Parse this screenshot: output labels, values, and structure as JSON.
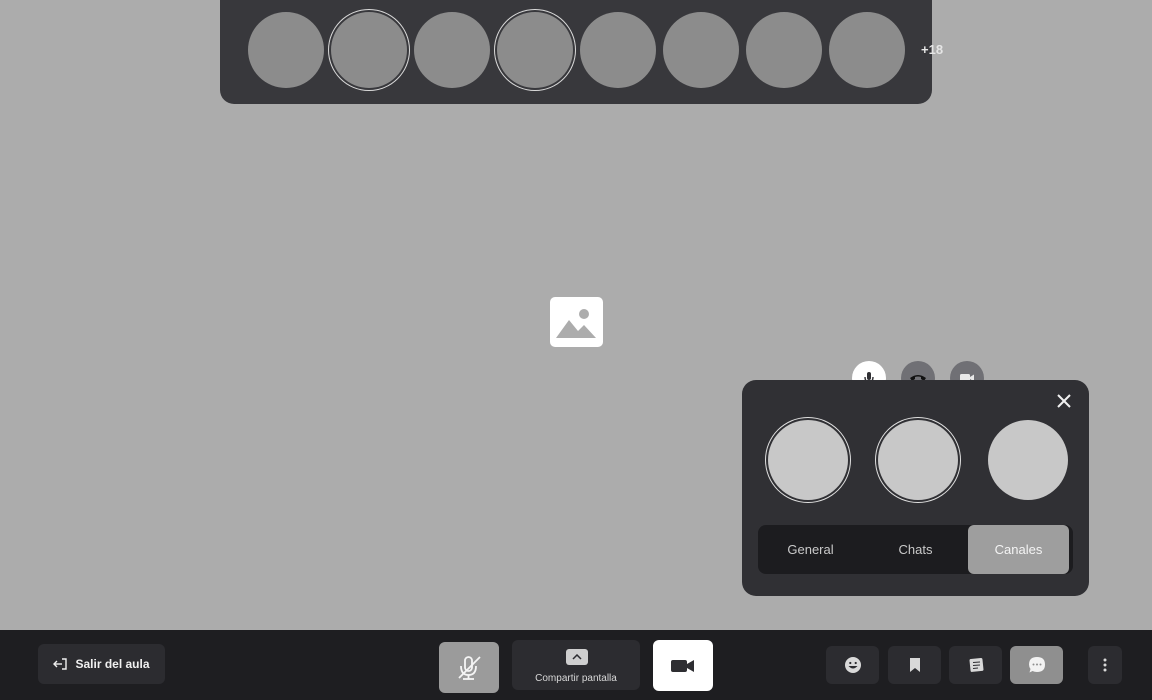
{
  "participants": {
    "more_count": "+18"
  },
  "call_panel": {
    "tabs": [
      {
        "label": "General"
      },
      {
        "label": "Chats"
      },
      {
        "label": "Canales"
      }
    ],
    "active_tab": "Canales"
  },
  "toolbar": {
    "leave_label": "Salir del aula",
    "share_label": "Compartir pantalla"
  }
}
